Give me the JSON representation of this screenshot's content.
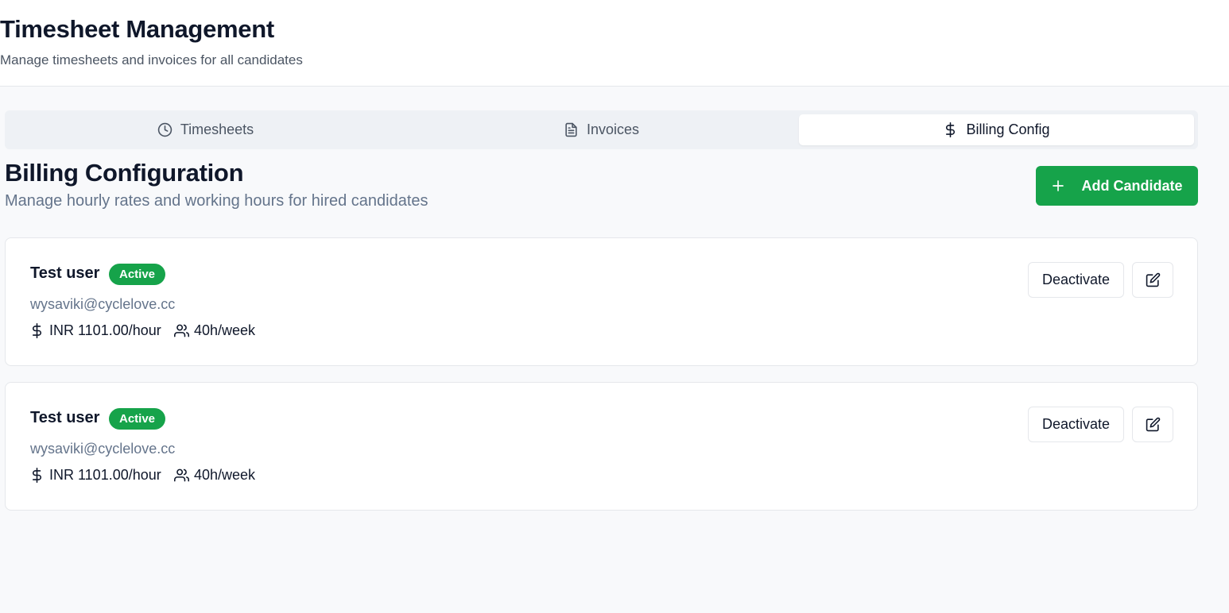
{
  "header": {
    "title": "Timesheet Management",
    "subtitle": "Manage timesheets and invoices for all candidates"
  },
  "tabs": [
    {
      "label": "Timesheets",
      "icon": "clock-icon",
      "active": false
    },
    {
      "label": "Invoices",
      "icon": "document-icon",
      "active": false
    },
    {
      "label": "Billing Config",
      "icon": "dollar-icon",
      "active": true
    }
  ],
  "section": {
    "title": "Billing Configuration",
    "subtitle": "Manage hourly rates and working hours for hired candidates",
    "add_button_label": "Add Candidate"
  },
  "candidates": [
    {
      "name": "Test user",
      "status": "Active",
      "email": "wysaviki@cyclelove.cc",
      "rate": "INR 1101.00/hour",
      "hours": "40h/week",
      "deactivate_label": "Deactivate"
    },
    {
      "name": "Test user",
      "status": "Active",
      "email": "wysaviki@cyclelove.cc",
      "rate": "INR 1101.00/hour",
      "hours": "40h/week",
      "deactivate_label": "Deactivate"
    }
  ],
  "colors": {
    "accent": "#16a34a",
    "text": "#0f172a",
    "muted": "#64748b"
  }
}
